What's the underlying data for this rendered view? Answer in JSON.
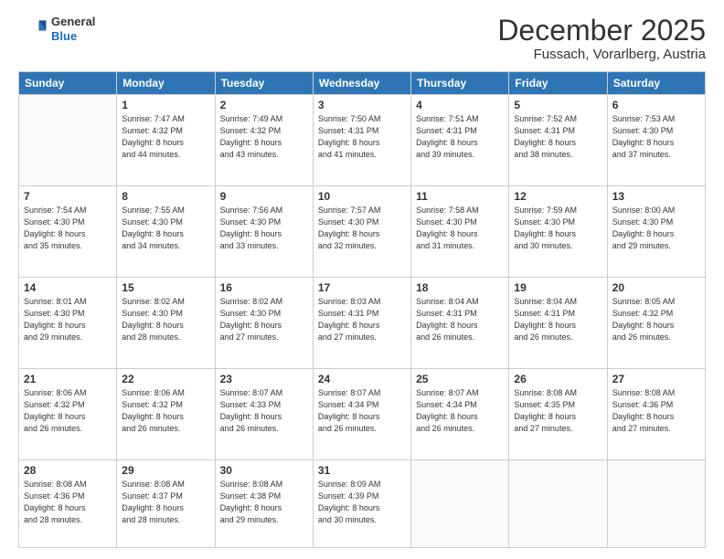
{
  "header": {
    "logo_general": "General",
    "logo_blue": "Blue",
    "main_title": "December 2025",
    "subtitle": "Fussach, Vorarlberg, Austria"
  },
  "days_of_week": [
    "Sunday",
    "Monday",
    "Tuesday",
    "Wednesday",
    "Thursday",
    "Friday",
    "Saturday"
  ],
  "weeks": [
    [
      {
        "day": "",
        "info": ""
      },
      {
        "day": "1",
        "info": "Sunrise: 7:47 AM\nSunset: 4:32 PM\nDaylight: 8 hours\nand 44 minutes."
      },
      {
        "day": "2",
        "info": "Sunrise: 7:49 AM\nSunset: 4:32 PM\nDaylight: 8 hours\nand 43 minutes."
      },
      {
        "day": "3",
        "info": "Sunrise: 7:50 AM\nSunset: 4:31 PM\nDaylight: 8 hours\nand 41 minutes."
      },
      {
        "day": "4",
        "info": "Sunrise: 7:51 AM\nSunset: 4:31 PM\nDaylight: 8 hours\nand 39 minutes."
      },
      {
        "day": "5",
        "info": "Sunrise: 7:52 AM\nSunset: 4:31 PM\nDaylight: 8 hours\nand 38 minutes."
      },
      {
        "day": "6",
        "info": "Sunrise: 7:53 AM\nSunset: 4:30 PM\nDaylight: 8 hours\nand 37 minutes."
      }
    ],
    [
      {
        "day": "7",
        "info": "Sunrise: 7:54 AM\nSunset: 4:30 PM\nDaylight: 8 hours\nand 35 minutes."
      },
      {
        "day": "8",
        "info": "Sunrise: 7:55 AM\nSunset: 4:30 PM\nDaylight: 8 hours\nand 34 minutes."
      },
      {
        "day": "9",
        "info": "Sunrise: 7:56 AM\nSunset: 4:30 PM\nDaylight: 8 hours\nand 33 minutes."
      },
      {
        "day": "10",
        "info": "Sunrise: 7:57 AM\nSunset: 4:30 PM\nDaylight: 8 hours\nand 32 minutes."
      },
      {
        "day": "11",
        "info": "Sunrise: 7:58 AM\nSunset: 4:30 PM\nDaylight: 8 hours\nand 31 minutes."
      },
      {
        "day": "12",
        "info": "Sunrise: 7:59 AM\nSunset: 4:30 PM\nDaylight: 8 hours\nand 30 minutes."
      },
      {
        "day": "13",
        "info": "Sunrise: 8:00 AM\nSunset: 4:30 PM\nDaylight: 8 hours\nand 29 minutes."
      }
    ],
    [
      {
        "day": "14",
        "info": "Sunrise: 8:01 AM\nSunset: 4:30 PM\nDaylight: 8 hours\nand 29 minutes."
      },
      {
        "day": "15",
        "info": "Sunrise: 8:02 AM\nSunset: 4:30 PM\nDaylight: 8 hours\nand 28 minutes."
      },
      {
        "day": "16",
        "info": "Sunrise: 8:02 AM\nSunset: 4:30 PM\nDaylight: 8 hours\nand 27 minutes."
      },
      {
        "day": "17",
        "info": "Sunrise: 8:03 AM\nSunset: 4:31 PM\nDaylight: 8 hours\nand 27 minutes."
      },
      {
        "day": "18",
        "info": "Sunrise: 8:04 AM\nSunset: 4:31 PM\nDaylight: 8 hours\nand 26 minutes."
      },
      {
        "day": "19",
        "info": "Sunrise: 8:04 AM\nSunset: 4:31 PM\nDaylight: 8 hours\nand 26 minutes."
      },
      {
        "day": "20",
        "info": "Sunrise: 8:05 AM\nSunset: 4:32 PM\nDaylight: 8 hours\nand 26 minutes."
      }
    ],
    [
      {
        "day": "21",
        "info": "Sunrise: 8:06 AM\nSunset: 4:32 PM\nDaylight: 8 hours\nand 26 minutes."
      },
      {
        "day": "22",
        "info": "Sunrise: 8:06 AM\nSunset: 4:32 PM\nDaylight: 8 hours\nand 26 minutes."
      },
      {
        "day": "23",
        "info": "Sunrise: 8:07 AM\nSunset: 4:33 PM\nDaylight: 8 hours\nand 26 minutes."
      },
      {
        "day": "24",
        "info": "Sunrise: 8:07 AM\nSunset: 4:34 PM\nDaylight: 8 hours\nand 26 minutes."
      },
      {
        "day": "25",
        "info": "Sunrise: 8:07 AM\nSunset: 4:34 PM\nDaylight: 8 hours\nand 26 minutes."
      },
      {
        "day": "26",
        "info": "Sunrise: 8:08 AM\nSunset: 4:35 PM\nDaylight: 8 hours\nand 27 minutes."
      },
      {
        "day": "27",
        "info": "Sunrise: 8:08 AM\nSunset: 4:36 PM\nDaylight: 8 hours\nand 27 minutes."
      }
    ],
    [
      {
        "day": "28",
        "info": "Sunrise: 8:08 AM\nSunset: 4:36 PM\nDaylight: 8 hours\nand 28 minutes."
      },
      {
        "day": "29",
        "info": "Sunrise: 8:08 AM\nSunset: 4:37 PM\nDaylight: 8 hours\nand 28 minutes."
      },
      {
        "day": "30",
        "info": "Sunrise: 8:08 AM\nSunset: 4:38 PM\nDaylight: 8 hours\nand 29 minutes."
      },
      {
        "day": "31",
        "info": "Sunrise: 8:09 AM\nSunset: 4:39 PM\nDaylight: 8 hours\nand 30 minutes."
      },
      {
        "day": "",
        "info": ""
      },
      {
        "day": "",
        "info": ""
      },
      {
        "day": "",
        "info": ""
      }
    ]
  ]
}
